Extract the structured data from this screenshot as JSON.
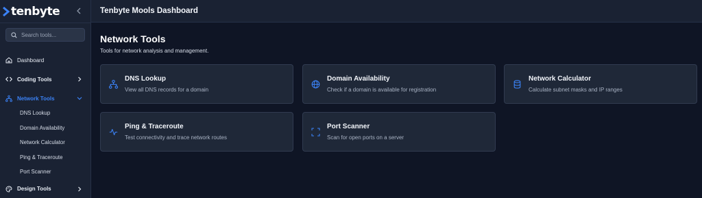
{
  "app": {
    "logo_text": "tenbyte",
    "header_title": "Tenbyte Mools Dashboard"
  },
  "search": {
    "placeholder": "Search tools..."
  },
  "sidebar": {
    "items": [
      {
        "label": "Dashboard",
        "icon": "home-icon"
      },
      {
        "label": "Coding Tools",
        "icon": "code-icon"
      },
      {
        "label": "Network Tools",
        "icon": "network-icon",
        "active": true
      },
      {
        "label": "Design Tools",
        "icon": "palette-icon"
      }
    ],
    "network_subitems": [
      "DNS Lookup",
      "Domain Availability",
      "Network Calculator",
      "Ping & Traceroute",
      "Port Scanner"
    ]
  },
  "main": {
    "title": "Network Tools",
    "subtitle": "Tools for network analysis and management.",
    "cards": [
      {
        "title": "DNS Lookup",
        "description": "View all DNS records for a domain",
        "icon": "sitemap-icon"
      },
      {
        "title": "Domain Availability",
        "description": "Check if a domain is available for registration",
        "icon": "globe-icon"
      },
      {
        "title": "Network Calculator",
        "description": "Calculate subnet masks and IP ranges",
        "icon": "database-icon"
      },
      {
        "title": "Ping & Traceroute",
        "description": "Test connectivity and trace network routes",
        "icon": "pulse-icon"
      },
      {
        "title": "Port Scanner",
        "description": "Scan for open ports on a server",
        "icon": "scan-icon"
      }
    ]
  },
  "colors": {
    "accent": "#3b82f6",
    "sidebar_bg": "#1a2233",
    "main_bg": "#0f1525",
    "card_bg": "#1f2838"
  }
}
